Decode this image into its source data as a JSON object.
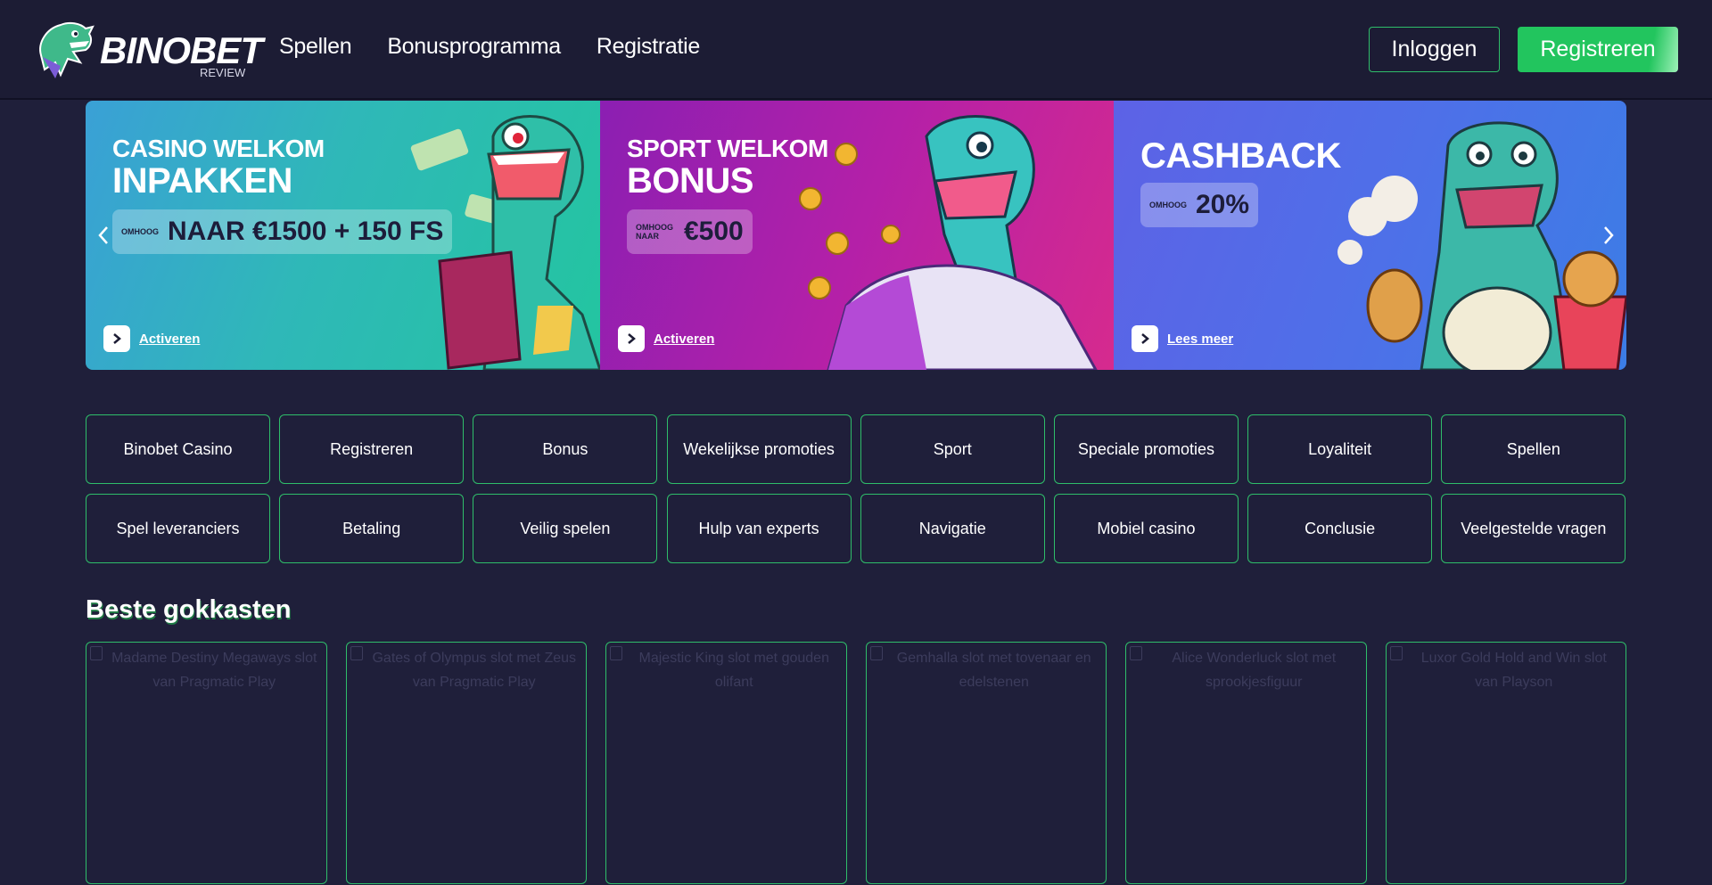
{
  "header": {
    "logo_text": "BINOBET",
    "logo_subtext": "REVIEW",
    "nav": [
      "Spellen",
      "Bonusprogramma",
      "Registratie"
    ],
    "login_label": "Inloggen",
    "register_label": "Registreren"
  },
  "banners": [
    {
      "kicker": "CASINO WELKOM",
      "title": "INPAKKEN",
      "offer_small": "OMHOOG",
      "offer_big": "NAAR €1500 + 150 FS",
      "link": "Activeren"
    },
    {
      "kicker": "SPORT WELKOM",
      "title": "BONUS",
      "offer_small": "OMHOOG NAAR",
      "offer_big": "€500",
      "link": "Activeren"
    },
    {
      "kicker": "",
      "title": "CASHBACK",
      "offer_small": "OMHOOG",
      "offer_big": "20%",
      "link": "Lees meer"
    }
  ],
  "categories": [
    "Binobet Casino",
    "Registreren",
    "Bonus",
    "Wekelijkse promoties",
    "Sport",
    "Speciale promoties",
    "Loyaliteit",
    "Spellen",
    "Spel leveranciers",
    "Betaling",
    "Veilig spelen",
    "Hulp van experts",
    "Navigatie",
    "Mobiel casino",
    "Conclusie",
    "Veelgestelde vragen"
  ],
  "slots_section": {
    "title": "Beste gokkasten",
    "items": [
      "Madame Destiny Megaways slot van Pragmatic Play",
      "Gates of Olympus slot met Zeus van Pragmatic Play",
      "Majestic King slot met gouden olifant",
      "Gemhalla slot met tovenaar en edelstenen",
      "Alice Wonderluck slot met sprookjesfiguur",
      "Luxor Gold Hold and Win slot van Playson"
    ]
  },
  "colors": {
    "background": "#1f1f3a",
    "header": "#1c1c34",
    "accent_green": "#22c55e",
    "border_green": "#2fbd6a"
  }
}
